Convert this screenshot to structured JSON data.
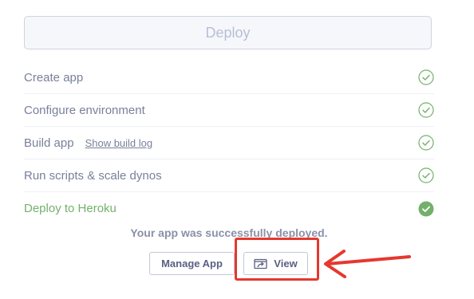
{
  "deploy_button_label": "Deploy",
  "steps": [
    {
      "label": "Create app",
      "state": "complete"
    },
    {
      "label": "Configure environment",
      "state": "complete"
    },
    {
      "label": "Build app",
      "link": "Show build log",
      "state": "complete"
    },
    {
      "label": "Run scripts & scale dynos",
      "state": "complete"
    },
    {
      "label": "Deploy to Heroku",
      "state": "done"
    }
  ],
  "status_message": "Your app was successfully deployed.",
  "buttons": {
    "manage_app": "Manage App",
    "view": "View"
  },
  "icons": {
    "step_check": "check-circle-outline-icon",
    "final_check": "check-circle-filled-icon",
    "view": "external-link-icon"
  },
  "colors": {
    "success_green": "#74b06c",
    "annotation_red": "#e5382f",
    "text_muted": "#79809a",
    "button_text": "#5b5f84"
  }
}
